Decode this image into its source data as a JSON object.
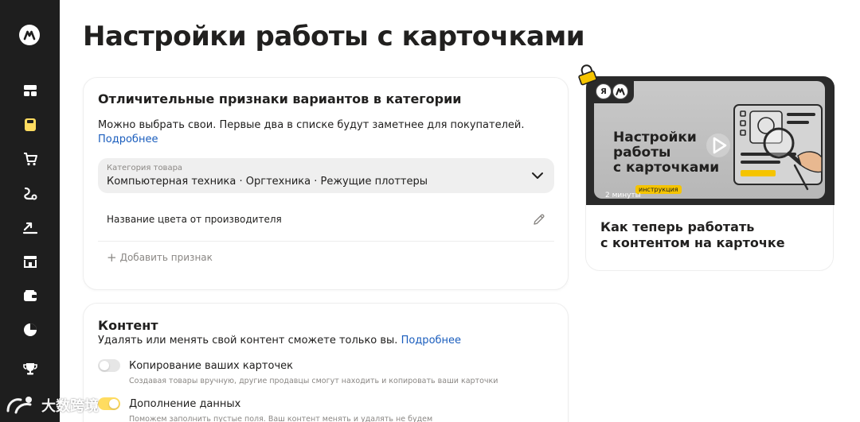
{
  "page": {
    "title": "Настройки работы с карточками"
  },
  "sidebar": {
    "items": [
      {
        "icon": "dashboard-icon"
      },
      {
        "icon": "product-card-icon",
        "active": true
      },
      {
        "icon": "cart-icon"
      },
      {
        "icon": "logistics-icon"
      },
      {
        "icon": "growth-icon"
      },
      {
        "icon": "store-icon"
      },
      {
        "icon": "wallet-icon"
      },
      {
        "icon": "analytics-icon"
      },
      {
        "icon": "trophy-icon"
      }
    ]
  },
  "variants_card": {
    "title": "Отличительные признаки вариантов в категории",
    "description": "Можно выбрать свои. Первые два в списке будут заметнее для покупателей.",
    "link": "Подробнее",
    "category_select": {
      "label": "Категория товара",
      "value": "Компьютерная техника · Оргтехника · Режущие плоттеры"
    },
    "attribute": "Название цвета от производителя",
    "add_attribute": "Добавить признак"
  },
  "content_card": {
    "title": "Контент",
    "description": "Удалять или менять свой контент сможете только вы.",
    "link": "Подробнее",
    "options": [
      {
        "title": "Копирование ваших карточек",
        "subtitle": "Создавая товары вручную, другие продавцы смогут находить и копировать ваши карточки",
        "enabled": false
      },
      {
        "title": "Дополнение данных",
        "subtitle": "Поможем заполнить пустые поля. Ваш контент менять и удалять не будем",
        "enabled": true
      }
    ]
  },
  "video_card": {
    "thumb_logo_ya": "Я",
    "thumb_title": [
      "Настройки",
      "работы",
      "с карточками"
    ],
    "badge": "инструкция",
    "duration": "2 минуты",
    "title": [
      "Как теперь работать",
      "с контентом на карточке"
    ]
  },
  "watermark": {
    "text": "大数跨境"
  },
  "colors": {
    "sidebar_bg": "#1e1e1e",
    "accent_yellow": "#ffdc60",
    "link_blue": "#1a5dbd"
  }
}
